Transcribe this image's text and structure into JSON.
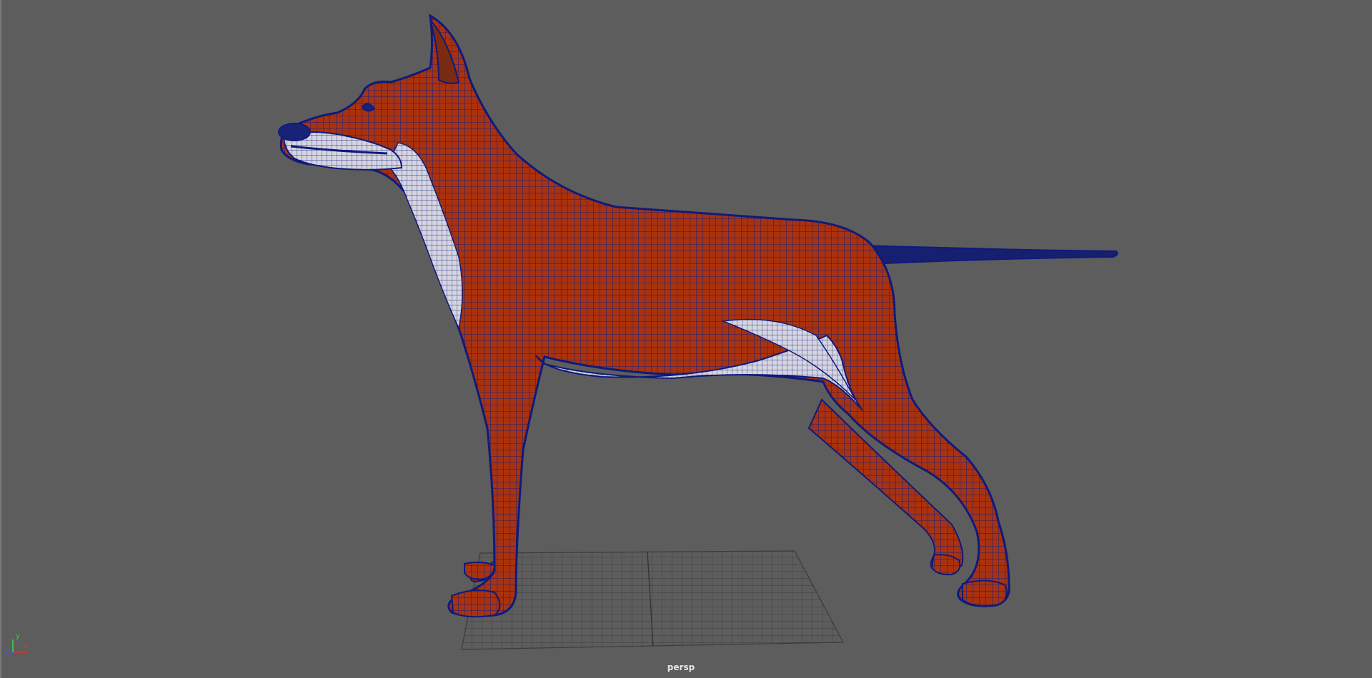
{
  "viewport": {
    "camera_name": "persp",
    "axis_labels": {
      "x": "x",
      "y": "y",
      "z": "z"
    }
  },
  "colors": {
    "background": "#5d5d5d",
    "fur_red": "#a8320f",
    "fur_white": "#d6d6e0",
    "wireframe": "#0f1a7a",
    "grid": "#3e3e3e",
    "axis_x": "#d33a2a",
    "axis_y": "#3bd13b",
    "axis_z": "#3a5ae0"
  },
  "scene_objects": {
    "model": "dog-mesh",
    "ground": "grid-plane"
  }
}
